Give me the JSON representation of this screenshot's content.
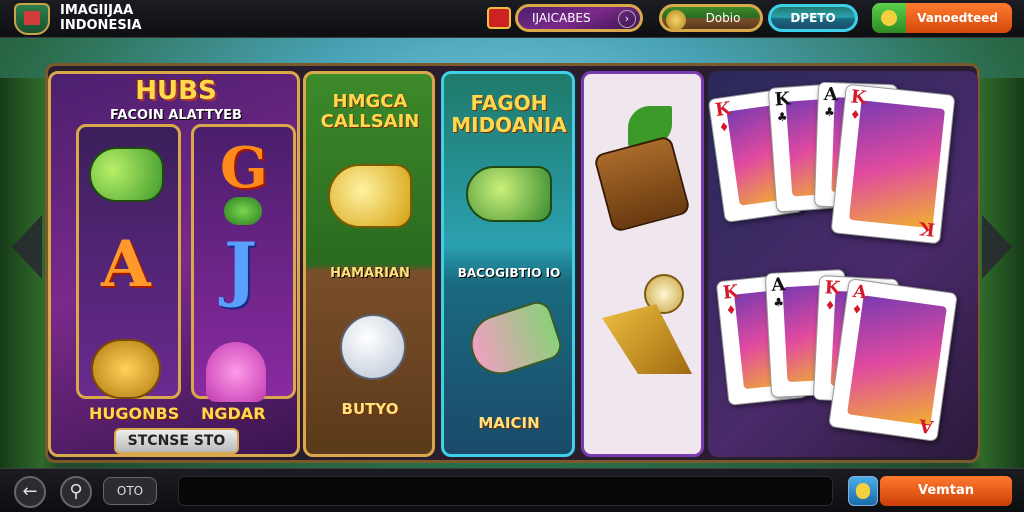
{
  "header": {
    "brand_line1": "IMAGIIJAA",
    "brand_line2": "INDONESIA",
    "pill1": "IJAICABES",
    "pill2": "Dobio",
    "pill3": "DPETO",
    "cta": "Vanoedteed"
  },
  "games": {
    "slot": {
      "title": "HUBS",
      "subtitle": "FACOIN ALATTYEB",
      "reel1_letter": "A",
      "reel2_letter": "J",
      "reel2_top": "G",
      "label_left": "HUGONBS",
      "label_right": "NGDAR",
      "spin_label": "STCNSE STO"
    },
    "fish1": {
      "title_line1": "HMGCA",
      "title_line2": "CALLSAIN",
      "label": "HAMARIAN",
      "label2": "BUTYO"
    },
    "fish2": {
      "title_line1": "FAGOH",
      "title_line2": "MIDOANIA",
      "label": "BACOGIBTIO IO",
      "label2": "MAICIN"
    },
    "cards": {
      "top": [
        {
          "rank": "K",
          "suit": "♦",
          "color": "red"
        },
        {
          "rank": "K",
          "suit": "♣",
          "color": "blk"
        },
        {
          "rank": "A",
          "suit": "♣",
          "color": "blk"
        },
        {
          "rank": "K",
          "suit": "♦",
          "color": "red"
        }
      ],
      "bottom": [
        {
          "rank": "K",
          "suit": "♦",
          "color": "red"
        },
        {
          "rank": "A",
          "suit": "♣",
          "color": "blk"
        },
        {
          "rank": "K",
          "suit": "♦",
          "color": "red"
        },
        {
          "rank": "A",
          "suit": "♦",
          "color": "red"
        }
      ]
    }
  },
  "footer": {
    "back_icon": "←",
    "person_icon": "⚲",
    "pill": "OTO",
    "cta": "Vemtan"
  },
  "colors": {
    "accent": "#ff7a2e",
    "gold": "#d9a84a"
  }
}
